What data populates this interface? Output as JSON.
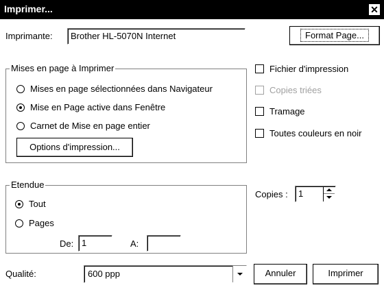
{
  "window": {
    "title": "Imprimer...",
    "close_glyph": "✕"
  },
  "printer": {
    "label": "Imprimante:",
    "value": "Brother HL-5070N Internet",
    "format_button_label": "Format Page..."
  },
  "layouts_group": {
    "legend": "Mises en page à Imprimer",
    "options": [
      {
        "label": "Mises en page sélectionnées dans Navigateur",
        "selected": false
      },
      {
        "label": "Mise en Page active dans Fenêtre",
        "selected": true
      },
      {
        "label": "Carnet de Mise en page entier",
        "selected": false
      }
    ],
    "options_button_label": "Options d'impression..."
  },
  "right_checks": [
    {
      "label": "Fichier d'impression",
      "checked": false,
      "enabled": true
    },
    {
      "label": "Copies triées",
      "checked": false,
      "enabled": false
    },
    {
      "label": "Tramage",
      "checked": false,
      "enabled": true
    },
    {
      "label": "Toutes couleurs en noir",
      "checked": false,
      "enabled": true
    }
  ],
  "range_group": {
    "legend": "Etendue",
    "all_label": "Tout",
    "all_selected": true,
    "pages_label": "Pages",
    "pages_selected": false,
    "from_label": "De:",
    "from_value": "1",
    "to_label": "A:",
    "to_value": ""
  },
  "copies": {
    "label": "Copies :",
    "value": "1"
  },
  "quality": {
    "label": "Qualité:",
    "value": "600 ppp"
  },
  "buttons": {
    "cancel": "Annuler",
    "print": "Imprimer"
  }
}
